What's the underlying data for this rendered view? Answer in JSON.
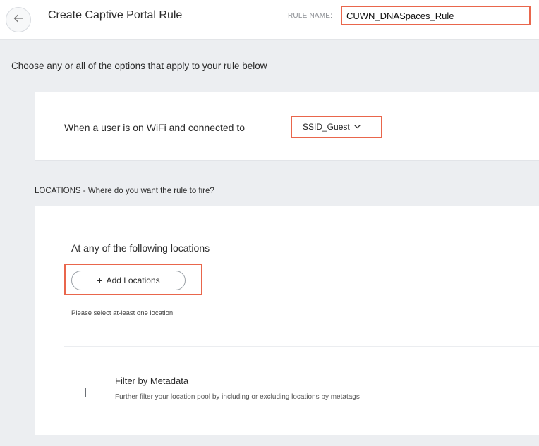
{
  "header": {
    "title": "Create Captive Portal Rule",
    "rule_name_label": "RULE NAME",
    "rule_name_value": "CUWN_DNASpaces_Rule"
  },
  "intro_text": "Choose any or all of the options that apply to your rule below",
  "wifi": {
    "condition_text": "When a user is on WiFi and connected to",
    "ssid_selected": "SSID_Guest"
  },
  "locations": {
    "section_label": "LOCATIONS - Where do you want the rule to fire?",
    "heading": "At any of the following locations",
    "add_button_label": "Add Locations",
    "hint": "Please select at-least one location"
  },
  "metadata_filter": {
    "title": "Filter by Metadata",
    "description": "Further filter your location pool by including or excluding locations by metatags",
    "checked": false
  },
  "colors": {
    "highlight": "#e9664c",
    "background": "#eceef1",
    "card": "#ffffff"
  },
  "icons": {
    "back": "arrow-left-icon",
    "dropdown": "chevron-down-icon",
    "add": "plus-icon"
  }
}
